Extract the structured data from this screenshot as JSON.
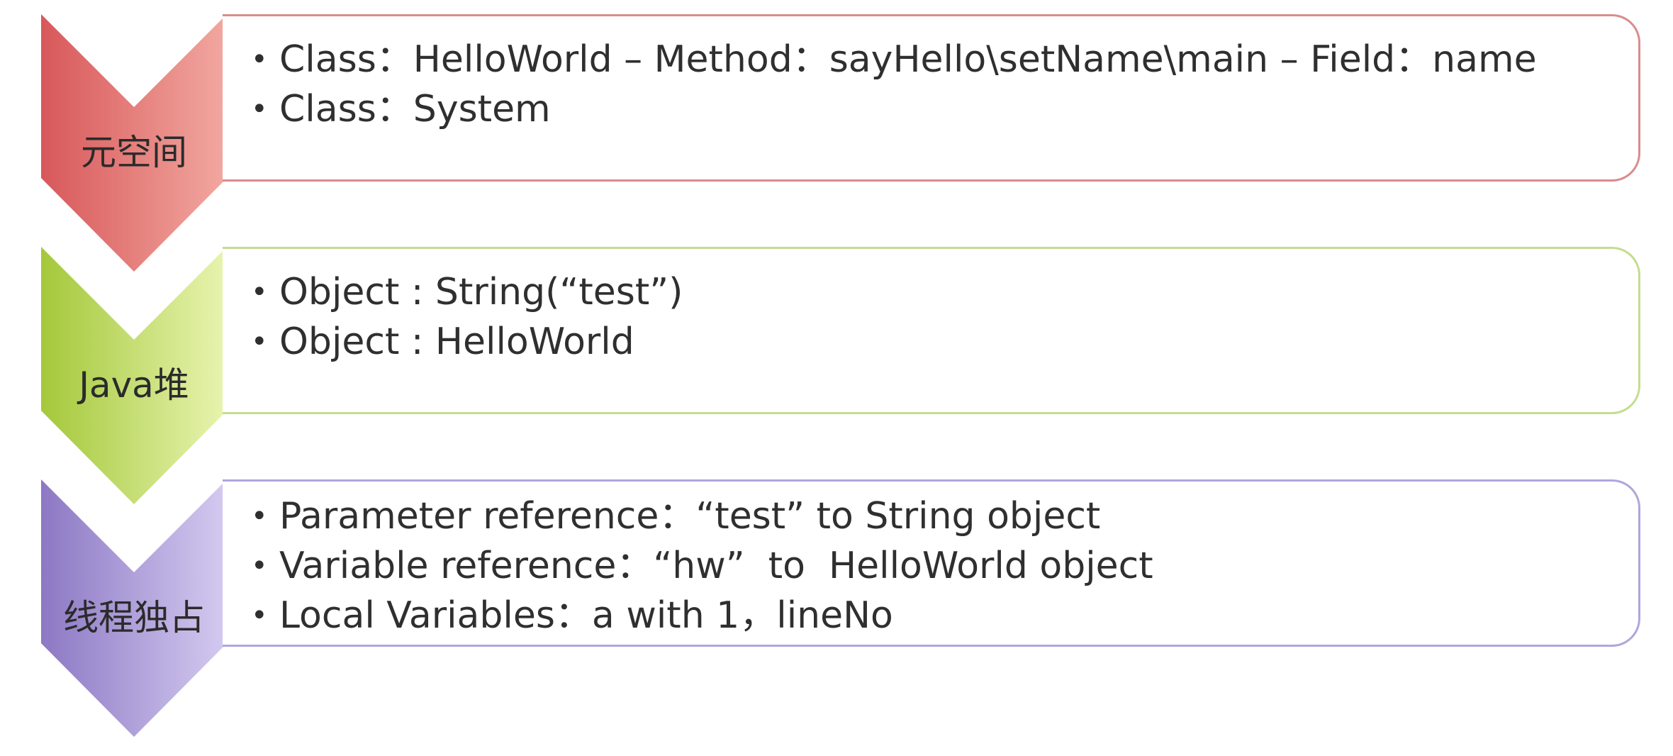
{
  "rows": [
    {
      "label": "元空间",
      "items": [
        "Class：HelloWorld – Method：sayHello\\setName\\main – Field：name",
        "Class：System"
      ],
      "colors": {
        "dark": "#d8585a",
        "light": "#f2a8a0",
        "border": "#d98c8c"
      }
    },
    {
      "label": "Java堆",
      "items": [
        "Object : String(“test”)",
        "Object : HelloWorld"
      ],
      "colors": {
        "dark": "#a4c83a",
        "light": "#e8f4b0",
        "border": "#c3dd8f"
      }
    },
    {
      "label": "线程独占",
      "items": [
        "Parameter reference：“test” to String object",
        "Variable reference：“hw”  to  HelloWorld object",
        "Local Variables：a with 1，lineNo"
      ],
      "colors": {
        "dark": "#8c78c4",
        "light": "#d4caf0",
        "border": "#b0a6dc"
      }
    }
  ]
}
